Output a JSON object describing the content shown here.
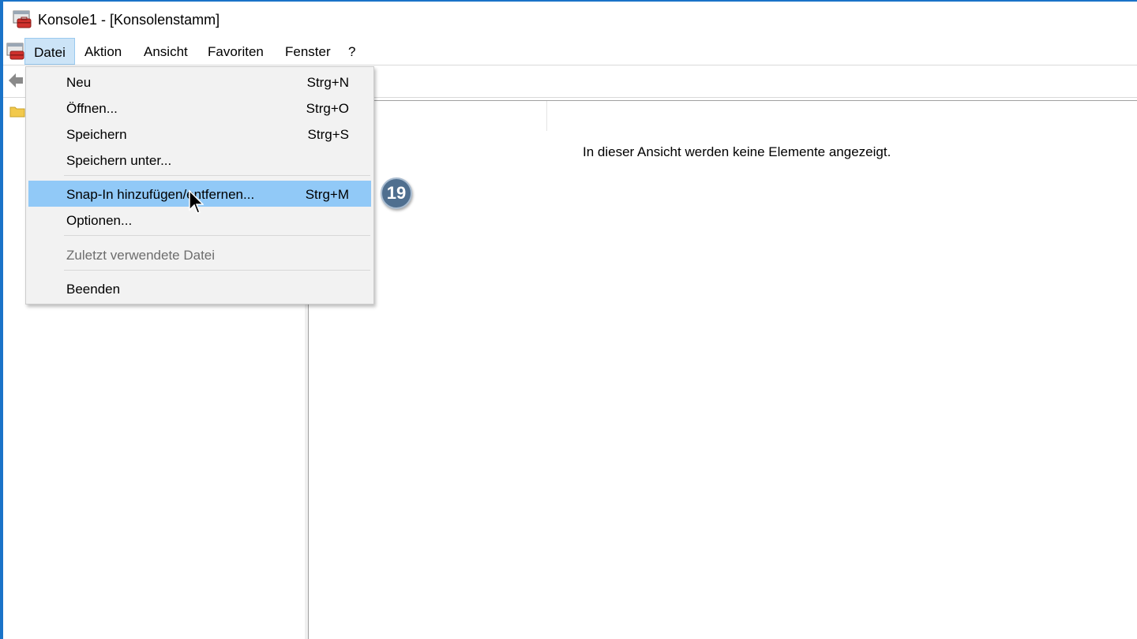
{
  "window": {
    "title": "Konsole1 - [Konsolenstamm]",
    "app_icon": "mmc-toolbox-icon"
  },
  "menubar": {
    "items": [
      "Datei",
      "Aktion",
      "Ansicht",
      "Favoriten",
      "Fenster",
      "?"
    ],
    "active": "Datei"
  },
  "file_menu": {
    "items": [
      {
        "label": "Neu",
        "shortcut": "Strg+N"
      },
      {
        "label": "Öffnen...",
        "shortcut": "Strg+O"
      },
      {
        "label": "Speichern",
        "shortcut": "Strg+S"
      },
      {
        "label": "Speichern unter...",
        "shortcut": ""
      },
      {
        "label": "Snap-In hinzufügen/entfernen...",
        "shortcut": "Strg+M"
      },
      {
        "label": "Optionen...",
        "shortcut": ""
      },
      {
        "label": "Zuletzt verwendete Datei",
        "shortcut": ""
      },
      {
        "label": "Beenden",
        "shortcut": ""
      }
    ],
    "highlighted": "Snap-In hinzufügen/entfernen...",
    "disabled": "Zuletzt verwendete Datei"
  },
  "list_pane": {
    "empty_message": "In dieser Ansicht werden keine Elemente angezeigt."
  },
  "step_badge": {
    "number": "19",
    "color": "#4f6f8f"
  },
  "colors": {
    "window_border": "#1a73c8",
    "menu_highlight": "#91c9f7",
    "menubar_active": "#cce4f7"
  }
}
